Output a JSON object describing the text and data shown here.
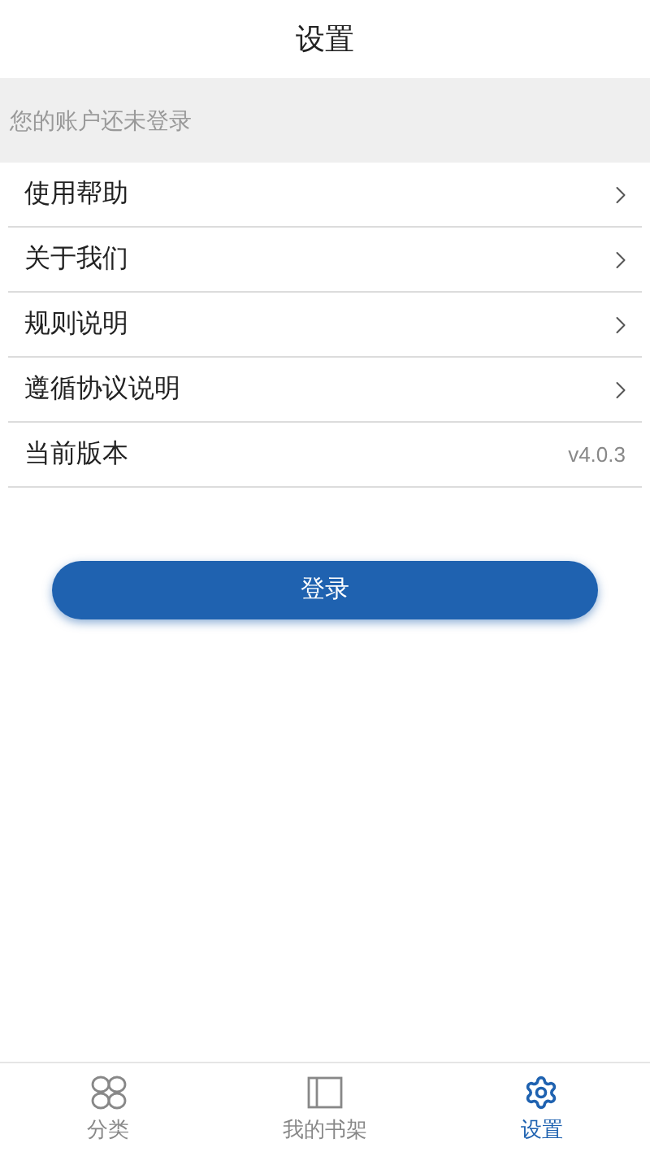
{
  "header": {
    "title": "设置"
  },
  "account_notice": "您的账户还未登录",
  "menu": [
    {
      "kind": "link",
      "label": "使用帮助"
    },
    {
      "kind": "link",
      "label": "关于我们"
    },
    {
      "kind": "link",
      "label": "规则说明"
    },
    {
      "kind": "link",
      "label": "遵循协议说明"
    },
    {
      "kind": "info",
      "label": "当前版本",
      "value": "v4.0.3"
    }
  ],
  "login_button": "登录",
  "tab_bar": [
    {
      "kind": "grid",
      "label": "分类",
      "selected": false
    },
    {
      "kind": "book",
      "label": "我的书架",
      "selected": false
    },
    {
      "kind": "gear",
      "label": "设置",
      "selected": true
    }
  ]
}
